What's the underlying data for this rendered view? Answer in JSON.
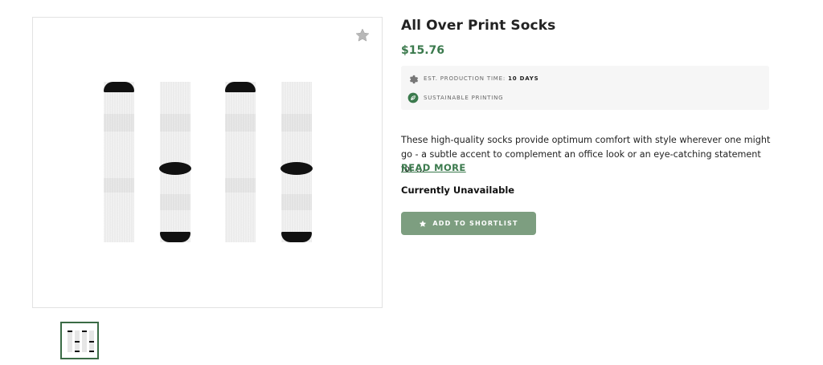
{
  "product": {
    "title": "All Over Print Socks",
    "price": "$15.76",
    "image_alt": "Product image of white all-over-print socks with black toe, heel and cuff",
    "favorite_icon": "star-icon"
  },
  "info": {
    "production_label": "EST. PRODUCTION TIME:",
    "production_value": "10 DAYS",
    "production_icon": "gear-icon",
    "sustainable_label": "SUSTAINABLE PRINTING",
    "sustainable_icon": "leaf-icon"
  },
  "description": {
    "text": "These high-quality socks provide optimum comfort with style wherever one might go - a subtle accent to complement an office look or an eye-catching statement for ...",
    "read_more": "READ MORE"
  },
  "availability": "Currently Unavailable",
  "shortlist_button": {
    "label": "ADD TO SHORTLIST",
    "icon": "star-icon"
  },
  "colors": {
    "accent_green": "#3b7a4d",
    "button_green": "#7d9e80",
    "info_bg": "#f6f6f6"
  }
}
